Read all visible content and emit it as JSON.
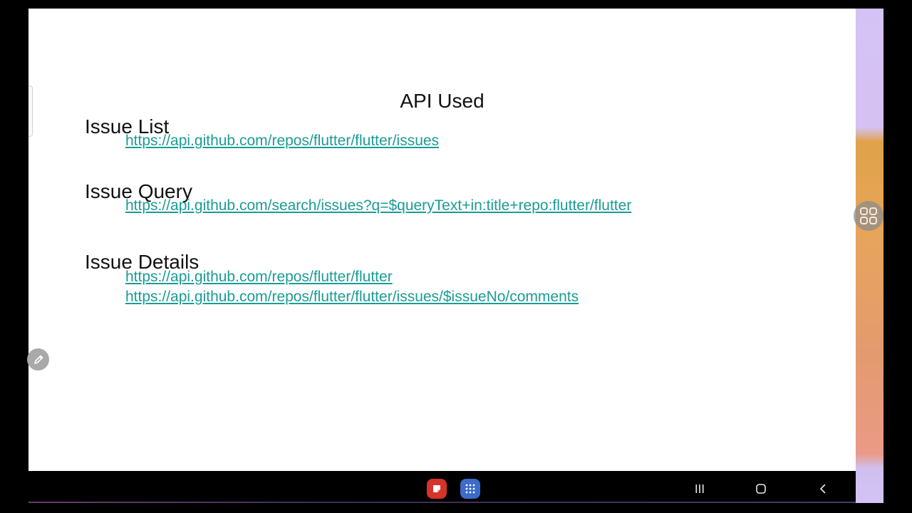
{
  "slide": {
    "title": "API Used",
    "sections": [
      {
        "heading": "Issue List",
        "links": [
          "https://api.github.com/repos/flutter/flutter/issues"
        ]
      },
      {
        "heading": "Issue Query",
        "links": [
          "https://api.github.com/search/issues?q=$queryText+in:title+repo:flutter/flutter"
        ]
      },
      {
        "heading": "Issue Details",
        "links": [
          "https://api.github.com/repos/flutter/flutter",
          "https://api.github.com/repos/flutter/flutter/issues/$issueNo/comments"
        ]
      }
    ]
  },
  "colors": {
    "link": "#1a9c95",
    "text": "#111111",
    "background": "#ffffff"
  },
  "icons": {
    "pen": "pencil-icon",
    "apps_bubble": "grid-four-icon",
    "taskbar_app_1": "note-app-icon",
    "taskbar_app_2": "app-drawer-icon",
    "nav_recents": "recents-icon",
    "nav_home": "home-icon",
    "nav_back": "back-icon"
  }
}
